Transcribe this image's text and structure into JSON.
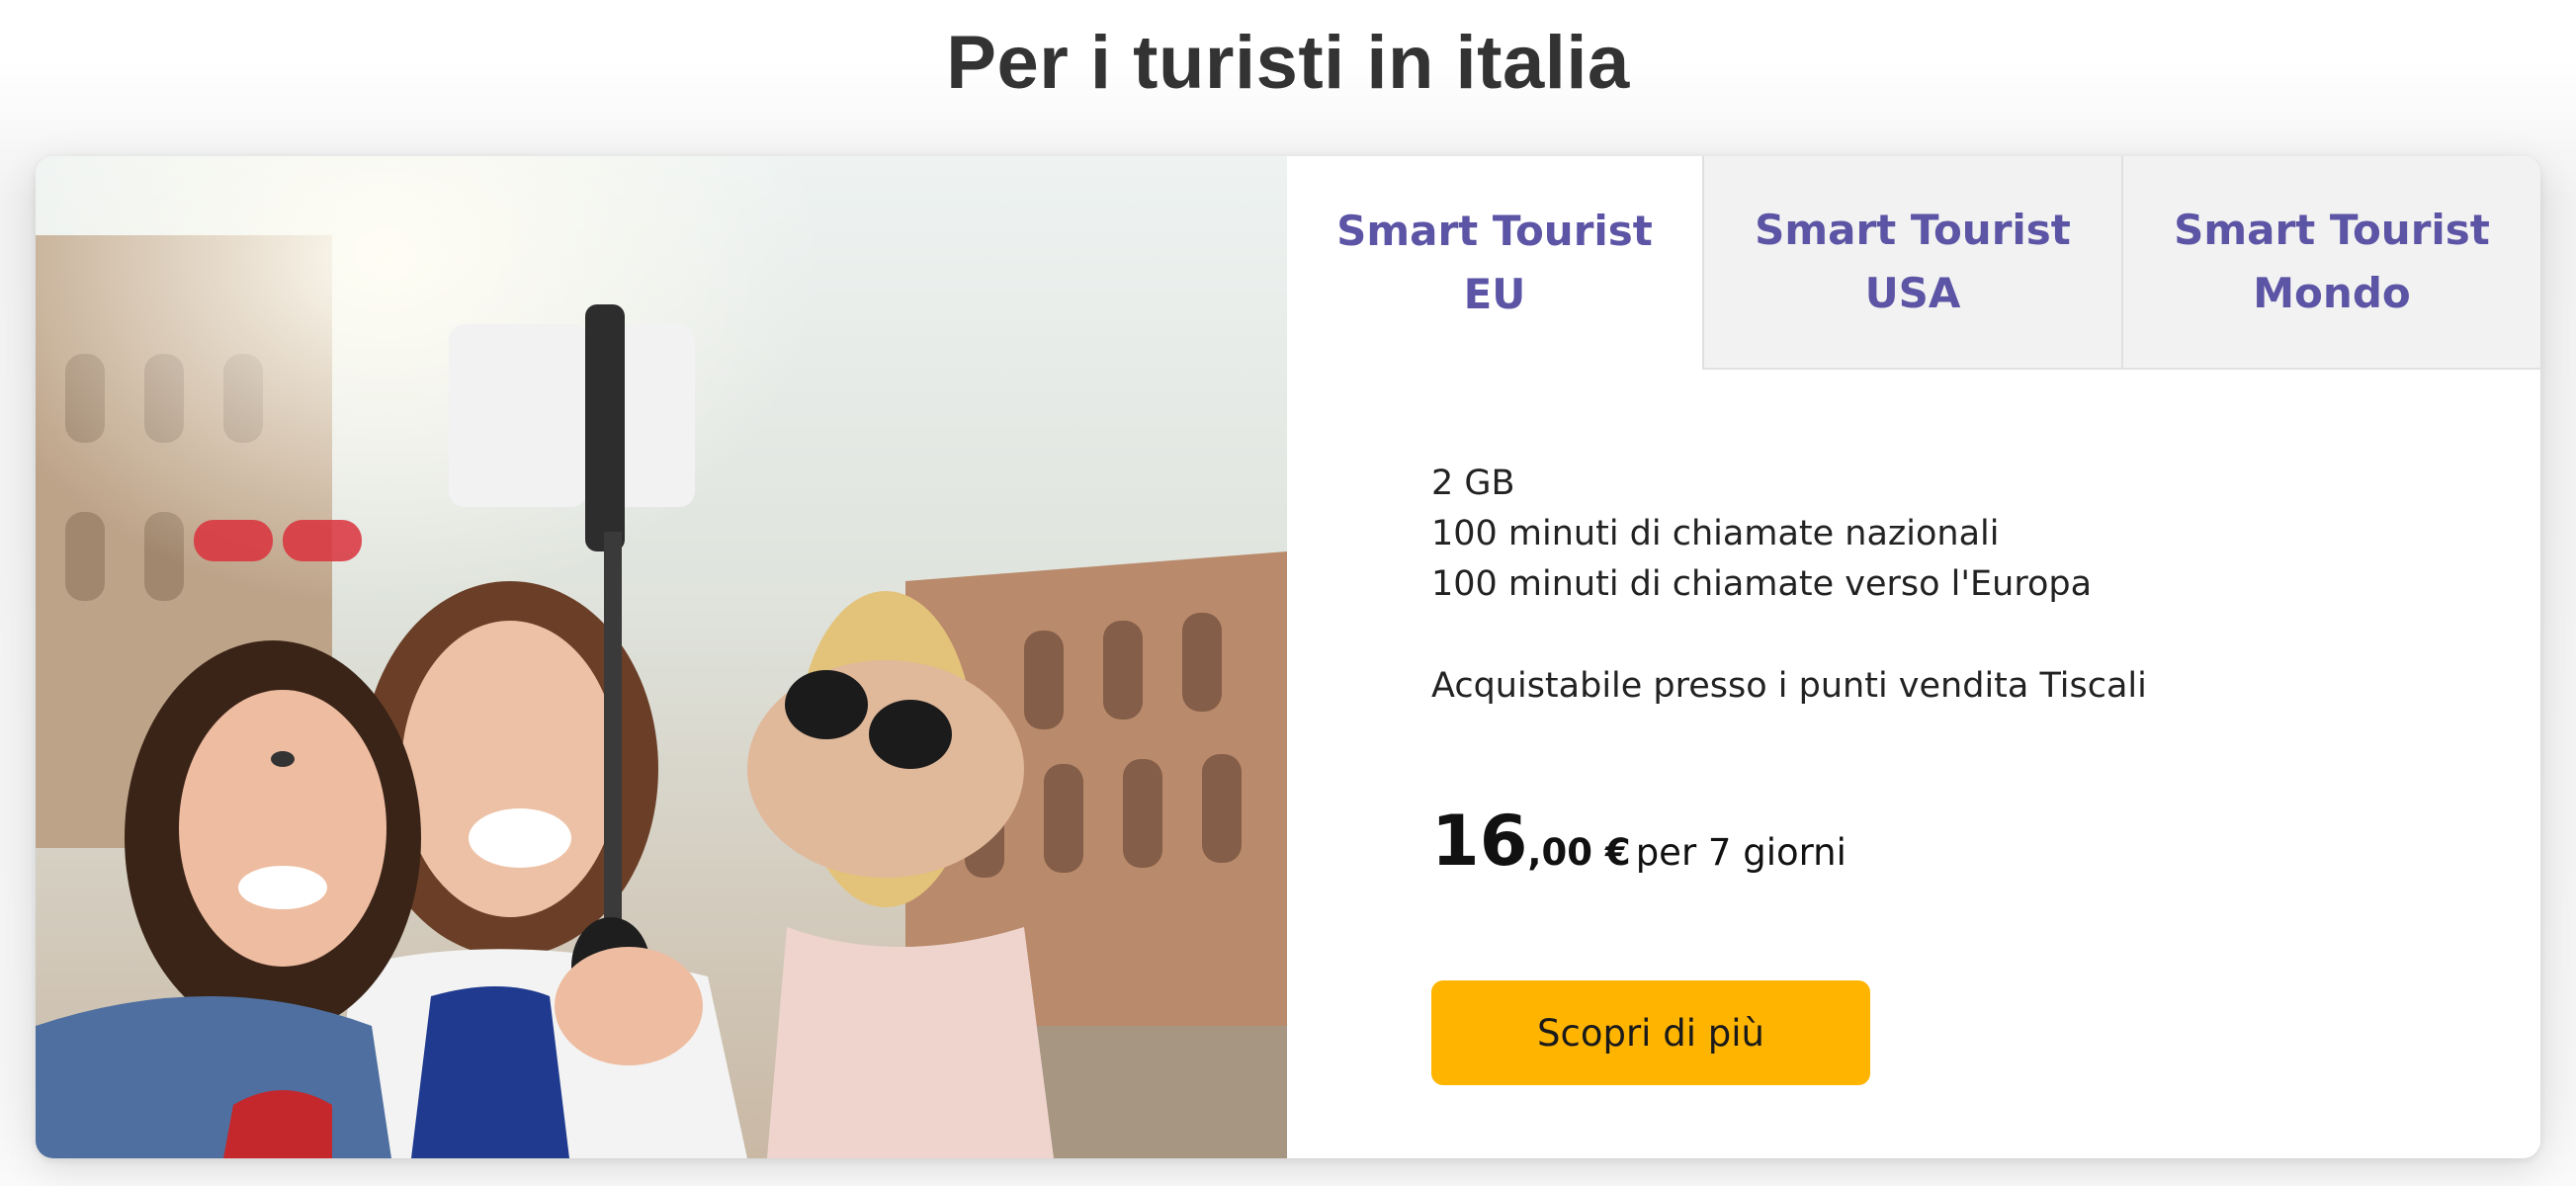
{
  "page": {
    "title": "Per i turisti in italia"
  },
  "colors": {
    "tab_text": "#5c54a4",
    "cta_background": "#ffb400",
    "inactive_tab_bg": "#f2f2f2"
  },
  "image": {
    "semantic": "three-women-selfie-colosseum-photo"
  },
  "tabs": [
    {
      "line1": "Smart Tourist",
      "line2": "EU",
      "active": true
    },
    {
      "line1": "Smart Tourist",
      "line2": "USA",
      "active": false
    },
    {
      "line1": "Smart Tourist",
      "line2": "Mondo",
      "active": false
    }
  ],
  "offer": {
    "features": [
      "2 GB",
      "100 minuti di chiamate nazionali",
      "100 minuti di chiamate verso l'Europa"
    ],
    "availability": "Acquistabile presso i punti vendita Tiscali",
    "price": {
      "integer": "16",
      "decimal": ",00 €",
      "period": "per 7 giorni"
    },
    "cta_label": "Scopri di più"
  }
}
